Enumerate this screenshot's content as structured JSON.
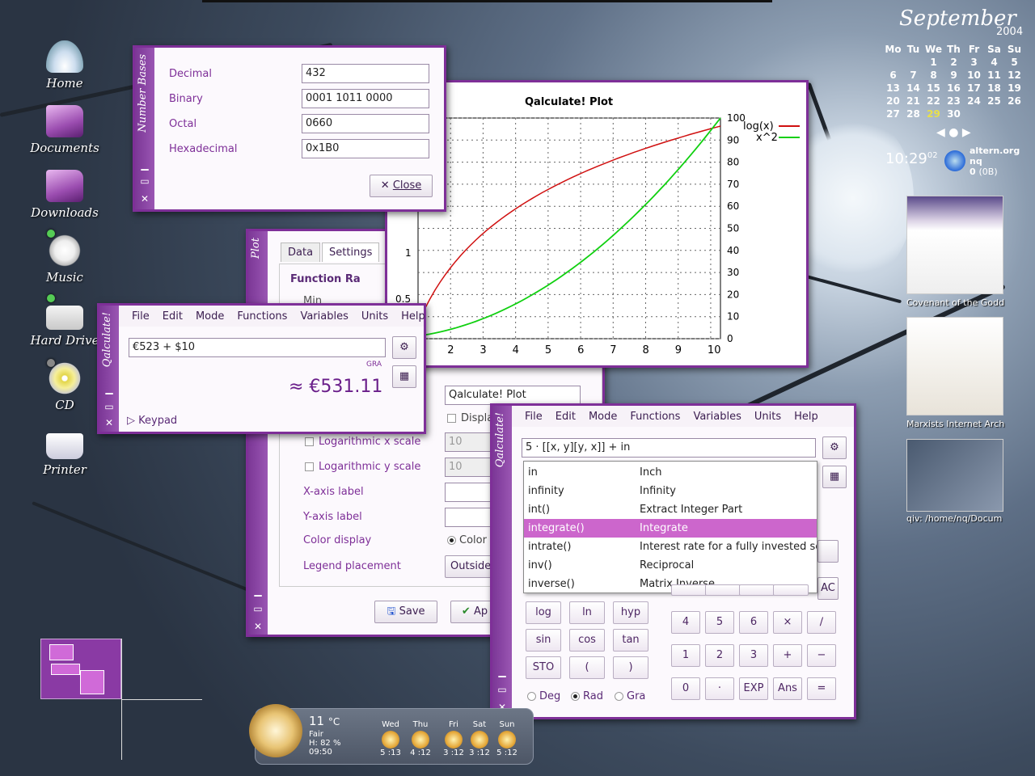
{
  "desktop": {
    "icons": [
      {
        "label": "Home",
        "icon": "home-icon"
      },
      {
        "label": "Documents",
        "icon": "folder-icon"
      },
      {
        "label": "Downloads",
        "icon": "folder-icon"
      },
      {
        "label": "Music",
        "icon": "music-icon"
      },
      {
        "label": "Hard Drive",
        "icon": "hard-drive-icon"
      },
      {
        "label": "CD",
        "icon": "cd-icon"
      },
      {
        "label": "Printer",
        "icon": "printer-icon"
      }
    ]
  },
  "calendar": {
    "month": "September",
    "year": "2004",
    "headers": [
      "Mo",
      "Tu",
      "We",
      "Th",
      "Fr",
      "Sa",
      "Su"
    ],
    "days": [
      "",
      "",
      "1",
      "2",
      "3",
      "4",
      "5",
      "6",
      "7",
      "8",
      "9",
      "10",
      "11",
      "12",
      "13",
      "14",
      "15",
      "16",
      "17",
      "18",
      "19",
      "20",
      "21",
      "22",
      "23",
      "24",
      "25",
      "26",
      "27",
      "28",
      "29",
      "30",
      "",
      "",
      ""
    ],
    "today": "29",
    "time": "10:29",
    "seconds": "02",
    "net_host": "altern.org",
    "net_user": "nq",
    "net_count": "0",
    "net_bytes": "(0B)"
  },
  "thumbnails": [
    {
      "label": "Covenant of the Godd"
    },
    {
      "label": "Marxists Internet Arch"
    },
    {
      "label": "qiv: /home/nq/Docum"
    }
  ],
  "number_bases": {
    "title": "Number Bases",
    "rows": [
      {
        "label": "Decimal",
        "value": "432"
      },
      {
        "label": "Binary",
        "value": "0001 1011 0000"
      },
      {
        "label": "Octal",
        "value": "0660"
      },
      {
        "label": "Hexadecimal",
        "value": "0x1B0"
      }
    ],
    "close": "Close"
  },
  "plot_window": {
    "title": "Qalculate! Plot",
    "legend": [
      "log(x)",
      "x^2"
    ],
    "colors": {
      "log": "#d01010",
      "sq": "#10d010"
    },
    "right_ticks": [
      "100",
      "90",
      "80",
      "70",
      "60",
      "50",
      "40",
      "30",
      "20",
      "10",
      "0"
    ],
    "left_ticks": [
      "1",
      "0.5"
    ],
    "x_ticks": [
      "2",
      "3",
      "4",
      "5",
      "6",
      "7",
      "8",
      "9",
      "10"
    ]
  },
  "plot_settings": {
    "title": "Plot",
    "tabs": [
      "Data",
      "Settings"
    ],
    "section": "Function Ra",
    "min_label": "Min",
    "title_value": "Qalculate! Plot",
    "display_label": "Displa",
    "log_x": "Logarithmic x scale",
    "log_y": "Logarithmic y scale",
    "log_x_base": "10",
    "log_y_base": "10",
    "x_axis": "X-axis label",
    "y_axis": "Y-axis label",
    "color_display": "Color display",
    "color_option": "Color",
    "legend_placement": "Legend placement",
    "legend_value": "Outside",
    "save": "Save",
    "apply": "Ap"
  },
  "calc_small": {
    "title": "Qalculate!",
    "menu": [
      "File",
      "Edit",
      "Mode",
      "Functions",
      "Variables",
      "Units",
      "Help"
    ],
    "expression": "€523 + $10",
    "mode": "GRA",
    "result": "≈ €531.11",
    "keypad": "Keypad"
  },
  "calc_main": {
    "title": "Qalculate!",
    "menu": [
      "File",
      "Edit",
      "Mode",
      "Functions",
      "Variables",
      "Units",
      "Help"
    ],
    "expression": "5 · [[x, y][y, x]] + in",
    "completions": [
      {
        "name": "in",
        "desc": "Inch"
      },
      {
        "name": "infinity",
        "desc": "Infinity"
      },
      {
        "name": "int()",
        "desc": "Extract Integer Part"
      },
      {
        "name": "integrate()",
        "desc": "Integrate"
      },
      {
        "name": "intrate()",
        "desc": "Interest rate for a fully invested se"
      },
      {
        "name": "inv()",
        "desc": "Reciprocal"
      },
      {
        "name": "inverse()",
        "desc": "Matrix Inverse"
      }
    ],
    "selected": "integrate()",
    "func_keys": [
      "log",
      "ln",
      "hyp",
      "sin",
      "cos",
      "tan",
      "STO",
      "(",
      ")"
    ],
    "num_keys": [
      "4",
      "5",
      "6",
      "×",
      "∕",
      "1",
      "2",
      "3",
      "+",
      "−",
      "0",
      "·",
      "EXP",
      "Ans",
      "="
    ],
    "ac": "AC",
    "angle": [
      "Deg",
      "Rad",
      "Gra"
    ],
    "angle_selected": "Rad"
  },
  "weather": {
    "temp": "11",
    "unit": "°C",
    "cond": "Fair",
    "humidity": "H: 82 %",
    "time": "09:50",
    "days": [
      {
        "d": "Wed",
        "t": "5 :13"
      },
      {
        "d": "Thu",
        "t": "4 :12"
      },
      {
        "d": "Fri",
        "t": "3 :12"
      },
      {
        "d": "Sat",
        "t": "3 :12"
      },
      {
        "d": "Sun",
        "t": "5 :12"
      }
    ]
  }
}
